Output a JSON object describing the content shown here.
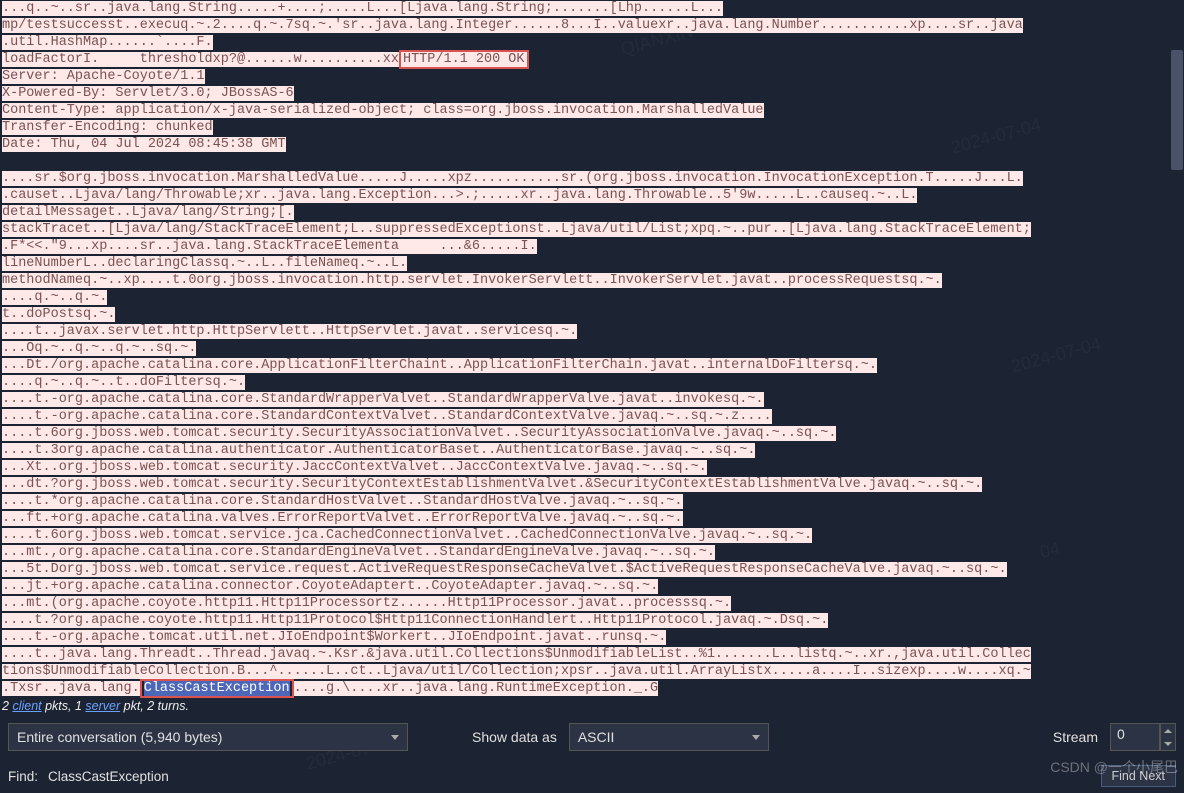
{
  "dump": {
    "pre1": "...q..~..sr..java.lang.String.....+....;.....L...[Ljava.lang.String;.......[Lhp......L...",
    "pre2": "mp/testsuccesst..execuq.~.2....q.~.7sq.~.'sr..java.lang.Integer......8...I..valuexr..java.lang.Number...........xp....sr..java",
    "pre3": ".util.HashMap......`....F.",
    "pre4a": "loadFactorI.     thresholdxp?@......w..........xx",
    "http_status": "HTTP/1.1 200 OK",
    "server": "Server: Apache-Coyote/1.1",
    "xpowered": "X-Powered-By: Servlet/3.0; JBossAS-6",
    "ctype": "Content-Type: application/x-java-serialized-object; class=org.jboss.invocation.MarshalledValue",
    "tenc": "Transfer-Encoding: chunked",
    "date": "Date: Thu, 04 Jul 2024 08:45:38 GMT",
    "b01": "....sr.$org.jboss.invocation.MarshalledValue.....J.....xpz...........sr.(org.jboss.invocation.InvocationException.T.....J...L.",
    "b02": ".causet..Ljava/lang/Throwable;xr..java.lang.Exception...>.;.....xr..java.lang.Throwable..5'9w.....L..causeq.~..L.",
    "b03": "detailMessaget..Ljava/lang/String;[.",
    "b04": "stackTracet..[Ljava/lang/StackTraceElement;L..suppressedExceptionst..Ljava/util/List;xpq.~..pur..[Ljava.lang.StackTraceElement;",
    "b05": ".F*<<.\"9...xp....sr..java.lang.StackTraceElementa     ...&6.....I.",
    "b06": "lineNumberL..declaringClassq.~..L..fileNameq.~..L.",
    "b07": "methodNameq.~..xp....t.0org.jboss.invocation.http.servlet.InvokerServlett..InvokerServlet.javat..processRequestsq.~.",
    "b08": "....q.~..q.~.",
    "b09": "t..doPostsq.~.",
    "b10": "....t..javax.servlet.http.HttpServlett..HttpServlet.javat..servicesq.~.",
    "b11": "...Oq.~..q.~..q.~..sq.~.",
    "b12": "...Dt./org.apache.catalina.core.ApplicationFilterChaint..ApplicationFilterChain.javat..internalDoFiltersq.~.",
    "b13": "....q.~..q.~..t..doFiltersq.~.",
    "b14": "....t.-org.apache.catalina.core.StandardWrapperValvet..StandardWrapperValve.javat..invokesq.~.",
    "b15": "....t.-org.apache.catalina.core.StandardContextValvet..StandardContextValve.javaq.~..sq.~.z....",
    "b16": "....t.6org.jboss.web.tomcat.security.SecurityAssociationValvet..SecurityAssociationValve.javaq.~..sq.~.",
    "b17": "....t.3org.apache.catalina.authenticator.AuthenticatorBaset..AuthenticatorBase.javaq.~..sq.~.",
    "b18": "...Xt..org.jboss.web.tomcat.security.JaccContextValvet..JaccContextValve.javaq.~..sq.~.",
    "b19": "...dt.?org.jboss.web.tomcat.security.SecurityContextEstablishmentValvet.&SecurityContextEstablishmentValve.javaq.~..sq.~.",
    "b20": "....t.*org.apache.catalina.core.StandardHostValvet..StandardHostValve.javaq.~..sq.~.",
    "b21": "...ft.+org.apache.catalina.valves.ErrorReportValvet..ErrorReportValve.javaq.~..sq.~.",
    "b22": "....t.6org.jboss.web.tomcat.service.jca.CachedConnectionValvet..CachedConnectionValve.javaq.~..sq.~.",
    "b23": "...mt.,org.apache.catalina.core.StandardEngineValvet..StandardEngineValve.javaq.~..sq.~.",
    "b24": "...5t.Dorg.jboss.web.tomcat.service.request.ActiveRequestResponseCacheValvet.$ActiveRequestResponseCacheValve.javaq.~..sq.~.",
    "b25": "...jt.+org.apache.catalina.connector.CoyoteAdaptert..CoyoteAdapter.javaq.~..sq.~.",
    "b26": "...mt.(org.apache.coyote.http11.Http11Processortz......Http11Processor.javat..processsq.~.",
    "b27": "....t.?org.apache.coyote.http11.Http11Protocol$Http11ConnectionHandlert..Http11Protocol.javaq.~.Dsq.~.",
    "b28": "....t.-org.apache.tomcat.util.net.JIoEndpoint$Workert..JIoEndpoint.javat..runsq.~.",
    "b29": "....t..java.lang.Threadt..Thread.javaq.~.Ksr.&java.util.Collections$UnmodifiableList..%1.......L..listq.~..xr.,java.util.Collec",
    "b30": "tions$UnmodifiableCollection.B...^......L..ct..Ljava/util/Collection;xpsr..java.util.ArrayListx.....a....I..sizexp....w....xq.~",
    "b31a": ".Txsr..java.lang.",
    "b31_exc": "ClassCastException",
    "b31b": "....g.\\....xr..java.lang.RuntimeException._.G"
  },
  "stats": {
    "prefix": "2 ",
    "client": "client",
    "mid1": " pkts, 1 ",
    "server": "server",
    "mid2": " pkt, 2 turns."
  },
  "controls": {
    "conversation": "Entire conversation (5,940 bytes)",
    "show_label": "Show data as",
    "encoding": "ASCII",
    "stream_label": "Stream",
    "stream_value": "0"
  },
  "find": {
    "label": "Find:",
    "value": "ClassCastException",
    "next": "Find Next"
  },
  "csdn": "CSDN @一个小尾巴"
}
